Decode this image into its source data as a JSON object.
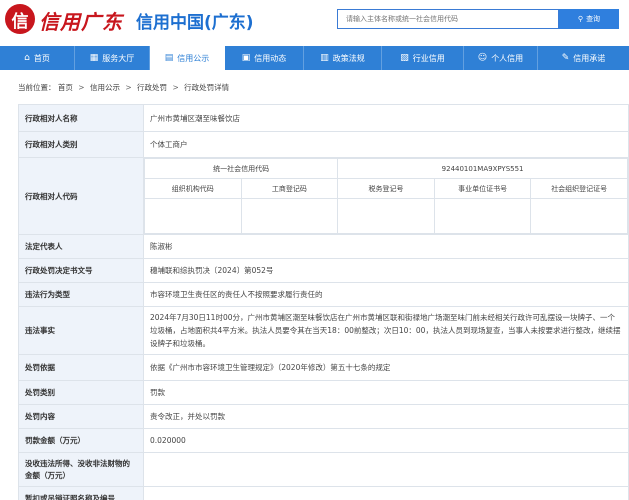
{
  "brand": {
    "logo_char": "信",
    "calligraphy": "信用广东",
    "name": "信用中国(广东)"
  },
  "search": {
    "placeholder": "请输入主体名称或统一社会信用代码",
    "button": "查询"
  },
  "nav": [
    {
      "label": "首页",
      "icon": "home-icon",
      "glyph": "⌂"
    },
    {
      "label": "服务大厅",
      "icon": "grid-icon",
      "glyph": "▦"
    },
    {
      "label": "信用公示",
      "icon": "doc-icon",
      "glyph": "▤",
      "active": true
    },
    {
      "label": "信用动态",
      "icon": "news-icon",
      "glyph": "▣"
    },
    {
      "label": "政策法规",
      "icon": "book-icon",
      "glyph": "▥"
    },
    {
      "label": "行业信用",
      "icon": "industry-icon",
      "glyph": "▧"
    },
    {
      "label": "个人信用",
      "icon": "person-icon",
      "glyph": "☺"
    },
    {
      "label": "信用承诺",
      "icon": "promise-icon",
      "glyph": "✎"
    }
  ],
  "breadcrumb": {
    "prefix": "当前位置：",
    "items": [
      "首页",
      "信用公示",
      "行政处罚",
      "行政处罚详情"
    ],
    "sep": ">"
  },
  "detail": {
    "rows": [
      {
        "label": "行政相对人名称",
        "value": "广州市黄埔区潮至味餐饮店"
      },
      {
        "label": "行政相对人类别",
        "value": "个体工商户"
      },
      {
        "label": "行政相对人代码",
        "codes": {
          "uscc_label": "统一社会信用代码",
          "uscc_value": "92440101MA9XPYS551",
          "sub_labels": [
            "组织机构代码",
            "工商登记码",
            "税务登记号",
            "事业单位证书号",
            "社会组织登记证号"
          ],
          "sub_values": [
            "",
            "",
            "",
            "",
            ""
          ]
        }
      },
      {
        "label": "法定代表人",
        "value": "陈淑彬"
      },
      {
        "label": "行政处罚决定书文号",
        "value": "穗埔联和综执罚决〔2024〕第052号"
      },
      {
        "label": "违法行为类型",
        "value": "市容环境卫生责任区的责任人不按照要求履行责任的"
      },
      {
        "label": "违法事实",
        "value": "2024年7月30日11时00分，广州市黄埔区潮至味餐饮店在广州市黄埔区联和街禄地广场潮至味门前未经相关行政许可乱摆设一块牌子、一个垃圾桶，占地面积共4平方米。执法人员要令其在当天18：00前整改；次日10：00，执法人员到现场复查，当事人未按要求进行整改，继续摆设牌子和垃圾桶。"
      },
      {
        "label": "处罚依据",
        "value": "依据《广州市市容环境卫生管理规定》（2020年修改）第五十七条的规定"
      },
      {
        "label": "处罚类别",
        "value": "罚款"
      },
      {
        "label": "处罚内容",
        "value": "责令改正，并处以罚款"
      },
      {
        "label": "罚款金额（万元）",
        "value": "0.020000"
      },
      {
        "label": "没收违法所得、没收非法财物的金额（万元）",
        "value": ""
      },
      {
        "label": "暂扣或吊销证照名称及编号",
        "value": ""
      }
    ]
  },
  "colors": {
    "brand_red": "#c8161d",
    "brand_blue": "#1d6fd0",
    "nav_blue": "#2f80d6",
    "label_bg": "#eef3fa"
  }
}
